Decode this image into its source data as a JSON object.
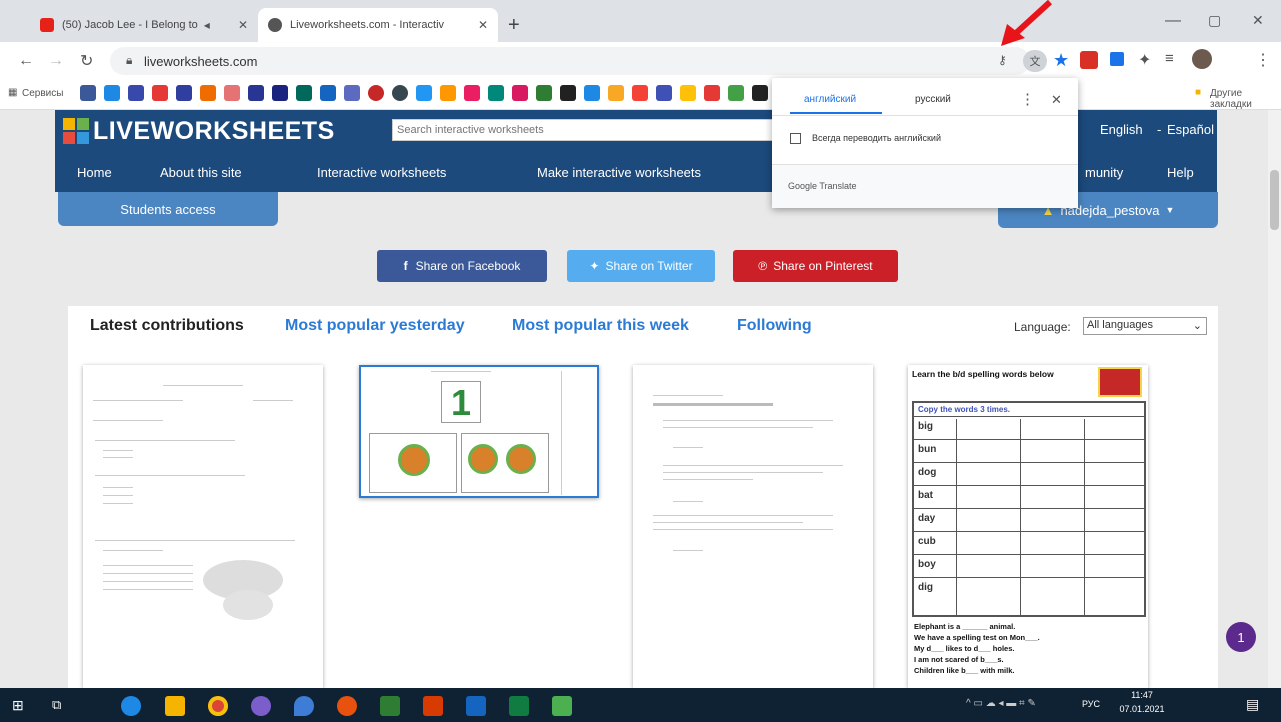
{
  "browser": {
    "tabs": [
      {
        "label": "(50) Jacob Lee - I Belong to"
      },
      {
        "label": "Liveworksheets.com - Interactiv"
      }
    ],
    "address": "liveworksheets.com",
    "other_bookmarks": "Другие закладки",
    "services": "Сервисы"
  },
  "translate_popup": {
    "lang_from": "английский",
    "lang_to": "русский",
    "always_translate": "Всегда переводить английский",
    "footer": "Google Translate"
  },
  "site": {
    "logo": "LIVEWORKSHEETS",
    "search_placeholder": "Search interactive worksheets",
    "lang_english": "English",
    "lang_sep": "-",
    "lang_spanish": "Español",
    "nav": [
      "Home",
      "About this site",
      "Interactive worksheets",
      "Make interactive worksheets",
      "munity",
      "Help"
    ],
    "students_access": "Students access",
    "user": "nadejda_pestova",
    "share": {
      "facebook": "Share on Facebook",
      "twitter": "Share on Twitter",
      "pinterest": "Share on Pinterest"
    },
    "tabs": [
      "Latest contributions",
      "Most popular yesterday",
      "Most popular this week",
      "Following"
    ],
    "language_label": "Language:",
    "language_value": "All languages",
    "thumb2_number": "1",
    "thumb4": {
      "title": "Learn the b/d spelling words below",
      "copy": "Copy the words 3 times.",
      "words": [
        "big",
        "bun",
        "dog",
        "bat",
        "day",
        "cub",
        "boy",
        "dig"
      ],
      "sentences": [
        "Elephant is a ______ animal.",
        "We have a spelling test on Mon___.",
        "My d___ likes to d___ holes.",
        "I am not scared of b___s.",
        "Children like b___ with milk."
      ]
    },
    "bubble_count": "1"
  },
  "taskbar": {
    "time": "11:47",
    "date": "07.01.2021",
    "lang": "РУС"
  },
  "colors": {
    "brand": "#1c4a7c",
    "facebook": "#3b5998",
    "twitter": "#55acee",
    "pinterest": "#cb2027",
    "link_blue": "#2b7bd6",
    "arrow": "#e8141a"
  }
}
